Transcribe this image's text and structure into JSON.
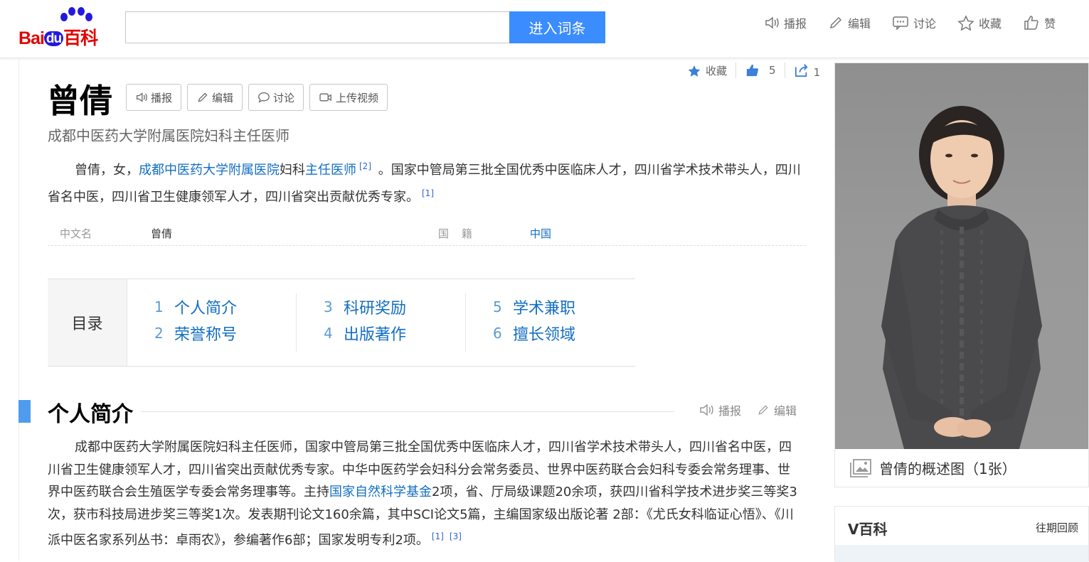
{
  "header": {
    "logo_text_bai": "Bai",
    "logo_text_du": "du",
    "logo_text_baike": "百科",
    "search_placeholder": "",
    "search_button": "进入词条",
    "actions": [
      {
        "label": "播报",
        "icon": "speaker-icon"
      },
      {
        "label": "编辑",
        "icon": "pencil-icon"
      },
      {
        "label": "讨论",
        "icon": "chat-icon"
      },
      {
        "label": "收藏",
        "icon": "star-icon"
      },
      {
        "label": "赞",
        "icon": "thumbs-up-icon"
      }
    ]
  },
  "mini_actions": {
    "collect": "收藏",
    "like_count": "5",
    "share_count": "1"
  },
  "entry": {
    "title": "曾倩",
    "buttons": [
      "播报",
      "编辑",
      "讨论",
      "上传视频"
    ],
    "subtitle": "成都中医药大学附属医院妇科主任医师",
    "summary": {
      "p1": "曾倩，女，",
      "link1": "成都中医药大学附属医院",
      "p2": "妇科",
      "link2": "主任医师",
      "ref1": "[2]",
      "p3": " 。国家中管局第三批全国优秀中医临床人才，四川省学术技术带头人，四川省名中医，四川省卫生健康领军人才，四川省突出贡献优秀专家。",
      "ref2": "[1]"
    }
  },
  "basic_info": {
    "name_label": "中文名",
    "name_value": "曾倩",
    "country_label": "国籍",
    "country_value": "中国"
  },
  "toc": {
    "label": "目录",
    "items": [
      {
        "num": "1",
        "text": "个人简介"
      },
      {
        "num": "2",
        "text": "荣誉称号"
      },
      {
        "num": "3",
        "text": "科研奖励"
      },
      {
        "num": "4",
        "text": "出版著作"
      },
      {
        "num": "5",
        "text": "学术兼职"
      },
      {
        "num": "6",
        "text": "擅长领域"
      }
    ]
  },
  "section1": {
    "title": "个人简介",
    "act_broadcast": "播报",
    "act_edit": "编辑",
    "body_a": "成都中医药大学附属医院妇科主任医师，国家中管局第三批全国优秀中医临床人才，四川省学术技术带头人，四川省名中医，四川省卫生健康领军人才，四川省突出贡献优秀专家。中华中医药学会妇科分会常务委员、世界中医药联合会妇科专委会常务理事、世界中医药联合会生殖医学专委会常务理事等。主持",
    "body_link": "国家自然科学基金",
    "body_b": "2项，省、厅局级课题20余项，获四川省科学技术进步奖三等奖3次，获市科技局进步奖三等奖1次。发表期刊论文160余篇，其中SCI论文5篇，主编国家级出版论著 2部：《尤氏女科临证心悟》、《川派中医名家系列丛书：卓雨农》，参编著作6部；国家发明专利2项。",
    "ref1": "[1]",
    "ref3": "[3]"
  },
  "sidebar": {
    "photo_caption": "曾倩的概述图（1张）",
    "v_title": "V百科",
    "v_more": "往期回顾"
  }
}
